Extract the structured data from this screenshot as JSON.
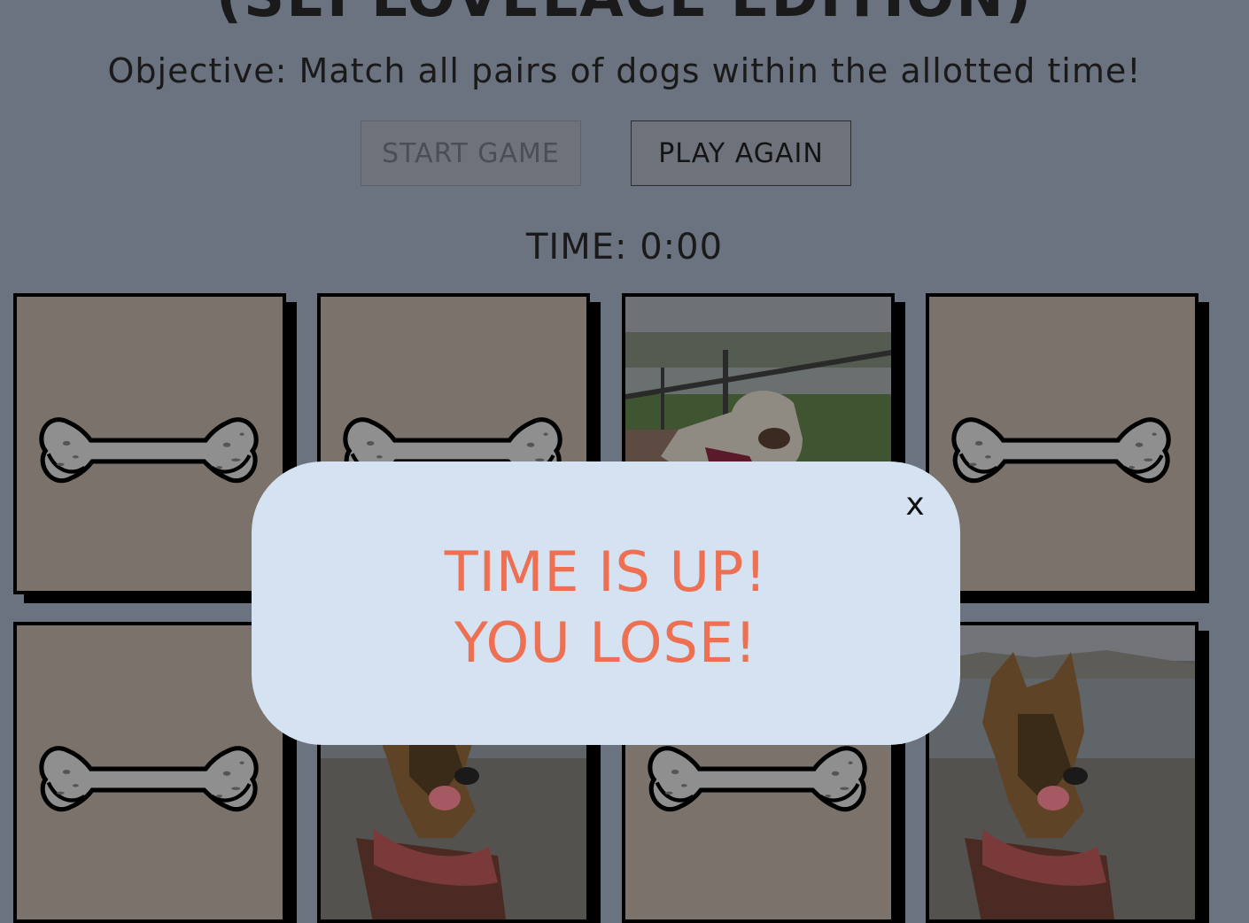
{
  "header": {
    "title": "(SEI LOVELACE EDITION)",
    "objective": "Objective: Match all pairs of dogs within the allotted time!"
  },
  "controls": {
    "start_label": "START GAME",
    "again_label": "PLAY AGAIN",
    "start_disabled": true
  },
  "timer": {
    "text": "TIME: 0:00"
  },
  "cards": [
    {
      "face": "bone-icon"
    },
    {
      "face": "bone-icon"
    },
    {
      "face": "dog-photo-labrador"
    },
    {
      "face": "bone-icon"
    },
    {
      "face": "bone-icon"
    },
    {
      "face": "dog-photo-german-shepherd"
    },
    {
      "face": "bone-icon"
    },
    {
      "face": "dog-photo-german-shepherd"
    }
  ],
  "modal": {
    "close_label": "x",
    "line1": "TIME IS UP!",
    "line2": "YOU LOSE!"
  },
  "colors": {
    "background": "#6b7280",
    "card_back": "#7b726b",
    "modal_bg": "#d5e2f1",
    "lose_text": "#ee7052"
  }
}
